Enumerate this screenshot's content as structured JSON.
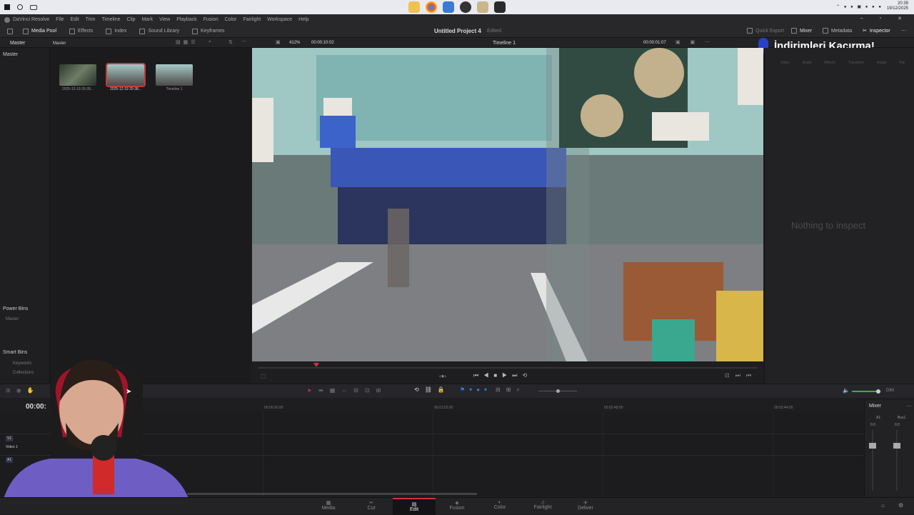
{
  "taskbar": {
    "time": "20:39",
    "date": "19/12/2025"
  },
  "menubar": {
    "app_name": "DaVinci Resolve",
    "items": [
      "File",
      "Edit",
      "Trim",
      "Timeline",
      "Clip",
      "Mark",
      "View",
      "Playback",
      "Fusion",
      "Color",
      "Fairlight",
      "Workspace",
      "Help"
    ]
  },
  "toolbar": {
    "media_pool": "Media Pool",
    "effects": "Effects",
    "index": "Index",
    "sound_library": "Sound Library",
    "keyframes": "Keyframes",
    "project_title": "Untitled Project 4",
    "project_status": "Edited",
    "quick_export": "Quick Export",
    "mixer": "Mixer",
    "metadata": "Metadata",
    "inspector": "Inspector"
  },
  "subbar": {
    "bin_label": "Master",
    "pool_label": "Master",
    "zoom": "412%",
    "timecode": "00:00:10:02",
    "timeline_name": "Timeline 1",
    "record_timecode": "00:00:01:07"
  },
  "bins": {
    "master": "Master",
    "power_bins": "Power Bins",
    "power_master": "Master",
    "smart_bins": "Smart Bins",
    "keywords": "Keywords",
    "collections": "Collections"
  },
  "clips": [
    {
      "label": "2025-12-19 20-28..."
    },
    {
      "label": "2025-12-19 20-38..."
    },
    {
      "label": "Timeline 1"
    }
  ],
  "inspector": {
    "tabs": [
      "Video",
      "Audio",
      "Effects",
      "Transition",
      "Image",
      "File"
    ],
    "empty": "Nothing to inspect"
  },
  "promo": {
    "text": "İndirimleri Kaçırma!"
  },
  "timeline": {
    "timecode": "00:00:",
    "ruler": [
      "00:00:26:00",
      "00:01:52:00",
      "00:02:48:00",
      "00:03:44:00"
    ],
    "track_v1": "V1",
    "track_v1_name": "Video 1",
    "track_a1": "A1",
    "dim": "DIM"
  },
  "mixer": {
    "title": "Mixer",
    "a1": "A1",
    "bus1": "Bus1",
    "v1": "0.0",
    "v2": "0.0"
  },
  "pages": [
    "Media",
    "Cut",
    "Edit",
    "Fusion",
    "Color",
    "Fairlight",
    "Deliver"
  ],
  "active_page": "Edit",
  "colors": {
    "accent_red": "#d4323c",
    "panel": "#222225",
    "viewer_sky": "#8ec3c2"
  }
}
